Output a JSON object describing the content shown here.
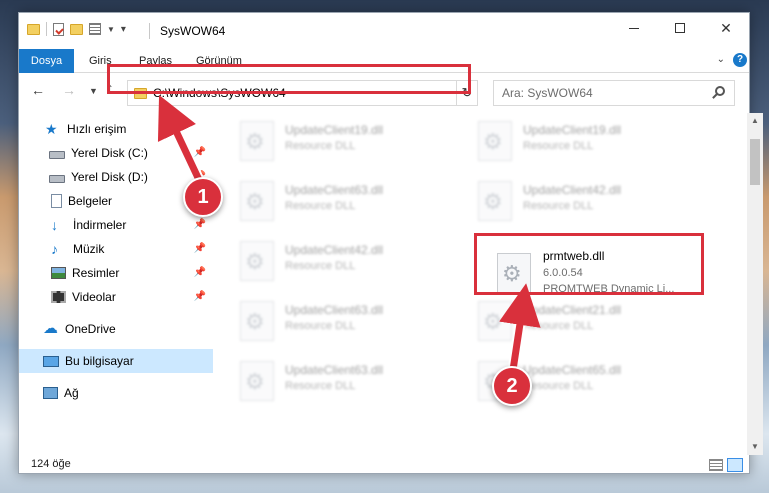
{
  "window": {
    "title": "SysWOW64"
  },
  "ribbon": {
    "tabs": [
      "Dosya",
      "Giriş",
      "Paylaş",
      "Görünüm"
    ]
  },
  "address": {
    "path": "C:\\Windows\\SysWOW64"
  },
  "search": {
    "placeholder": "Ara: SysWOW64"
  },
  "sidebar": {
    "items": [
      {
        "label": "Hızlı erişim",
        "icon": "star-icon",
        "pinned": false
      },
      {
        "label": "Yerel Disk (C:)",
        "icon": "disk-icon",
        "pinned": true
      },
      {
        "label": "Yerel Disk (D:)",
        "icon": "disk-icon",
        "pinned": true
      },
      {
        "label": "Belgeler",
        "icon": "documents-icon",
        "pinned": true
      },
      {
        "label": "İndirmeler",
        "icon": "download-icon",
        "pinned": true
      },
      {
        "label": "Müzik",
        "icon": "music-icon",
        "pinned": true
      },
      {
        "label": "Resimler",
        "icon": "pictures-icon",
        "pinned": true
      },
      {
        "label": "Videolar",
        "icon": "video-icon",
        "pinned": true
      },
      {
        "label": "OneDrive",
        "icon": "onedrive-icon",
        "pinned": false
      },
      {
        "label": "Bu bilgisayar",
        "icon": "computer-icon",
        "pinned": false,
        "selected": true
      },
      {
        "label": "Ağ",
        "icon": "network-icon",
        "pinned": false
      }
    ]
  },
  "files": [
    {
      "name": "UpdateClient19.dll",
      "desc": "Resource DLL"
    },
    {
      "name": "UpdateClient19.dll",
      "desc": "Resource DLL"
    },
    {
      "name": "UpdateClient63.dll",
      "desc": "Resource DLL"
    },
    {
      "name": "UpdateClient42.dll",
      "desc": "Resource DLL"
    },
    {
      "name": "UpdateClient42.dll",
      "desc": "Resource DLL"
    },
    {
      "name": "prmtweb.dll",
      "version": "6.0.0.54",
      "desc": "PROMTWEB Dynamic Li..."
    },
    {
      "name": "UpdateClient63.dll",
      "desc": "Resource DLL"
    },
    {
      "name": "UpdateClient21.dll",
      "desc": "Resource DLL"
    },
    {
      "name": "UpdateClient63.dll",
      "desc": "Resource DLL"
    },
    {
      "name": "UpdateClient65.dll",
      "desc": "Resource DLL"
    }
  ],
  "status": {
    "count": "124 öğe"
  },
  "callouts": [
    "1",
    "2"
  ],
  "colors": {
    "accent": "#1979ca",
    "highlight": "#d9303c",
    "selection": "#cce8ff"
  }
}
